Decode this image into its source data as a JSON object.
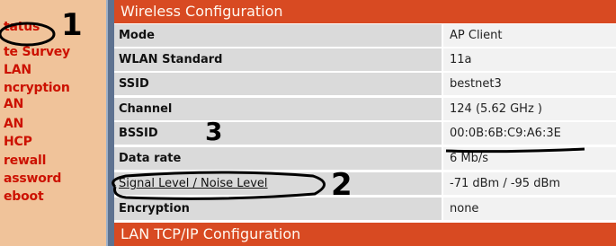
{
  "sidebar": {
    "items": [
      {
        "label": "tatus"
      },
      {
        "label": "te Survey"
      },
      {
        "label": "LAN"
      },
      {
        "label": "ncryption"
      },
      {
        "label": "AN"
      },
      {
        "label": "AN"
      },
      {
        "label": "HCP"
      },
      {
        "label": "rewall"
      },
      {
        "label": "assword"
      },
      {
        "label": "eboot"
      }
    ],
    "colors": {
      "background": "#f0c39a",
      "link": "#cc1100",
      "band": "#5e7290"
    }
  },
  "wireless": {
    "header": "Wireless Configuration",
    "rows": [
      {
        "label": "Mode",
        "value": "AP Client"
      },
      {
        "label": "WLAN Standard",
        "value": "11a"
      },
      {
        "label": "SSID",
        "value": "bestnet3"
      },
      {
        "label": "Channel",
        "value": "124 (5.62 GHz )"
      },
      {
        "label": "BSSID",
        "value": "00:0B:6B:C9:A6:3E"
      },
      {
        "label": "Data rate",
        "value": "6 Mb/s"
      },
      {
        "label": "Signal Level / Noise Level",
        "value": "-71 dBm / -95 dBm"
      },
      {
        "label": "Encryption",
        "value": "none"
      }
    ],
    "colors": {
      "header": "#d84a22",
      "label_cell": "#dadada",
      "value_cell": "#f2f2f2"
    }
  },
  "lan": {
    "header": "LAN TCP/IP Configuration"
  },
  "annotations": {
    "one": "1",
    "two": "2",
    "three": "3"
  }
}
